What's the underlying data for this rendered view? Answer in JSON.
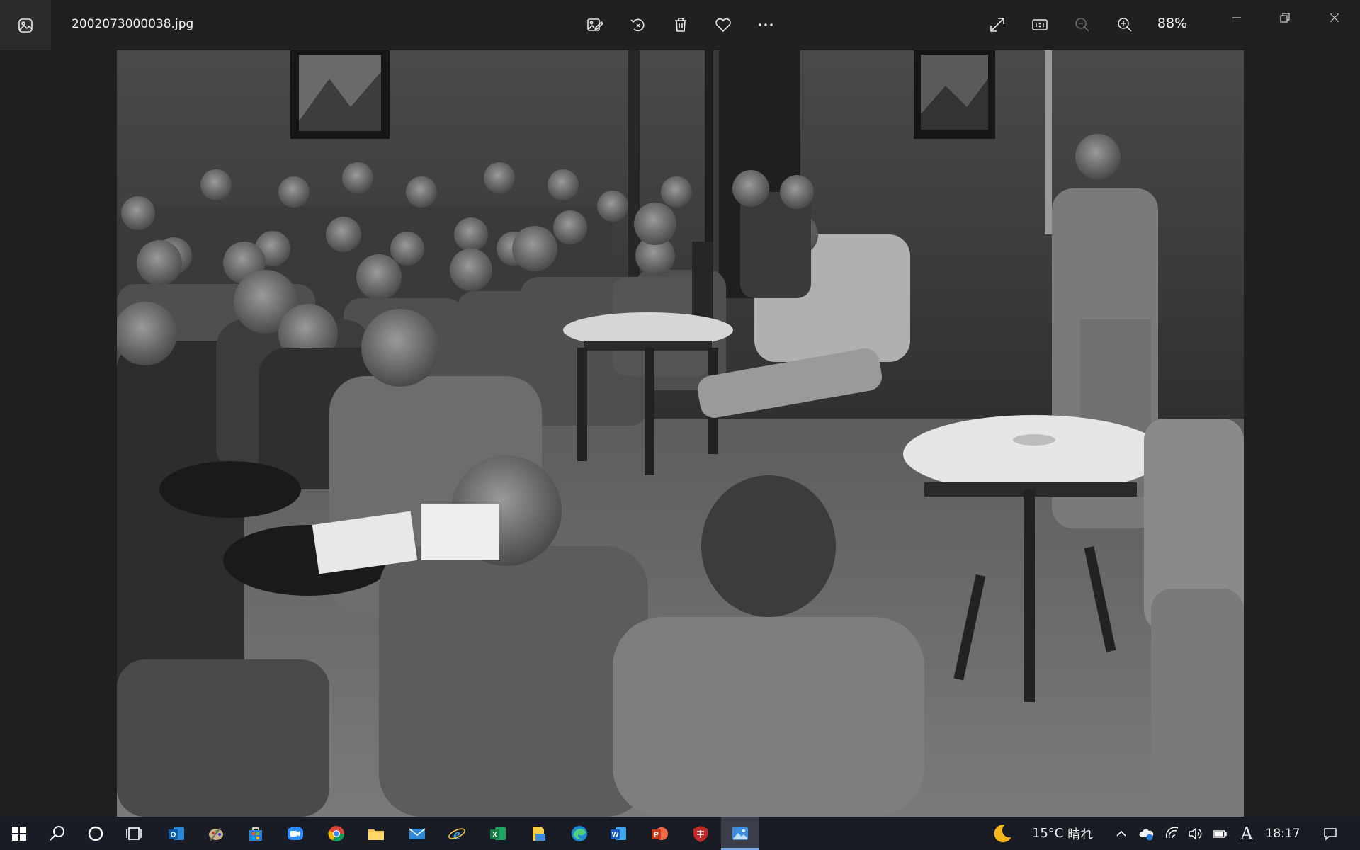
{
  "window": {
    "file_name": "2002073000038.jpg",
    "zoom_level": "88%"
  },
  "toolbar": {
    "app_icon": "photos-app-icon",
    "actions": [
      "edit-icon",
      "rotate-icon",
      "delete-icon",
      "favorite-icon",
      "more-icon"
    ],
    "view_actions": [
      "fullscreen-icon",
      "actual-size-icon",
      "zoom-out-icon",
      "zoom-in-icon"
    ]
  },
  "window_controls": [
    "minimize-icon",
    "restore-icon",
    "close-icon"
  ],
  "taskbar": {
    "apps": [
      "start-icon",
      "search-icon",
      "cortana-icon",
      "task-view-icon",
      "outlook-icon",
      "paint-icon",
      "store-icon",
      "zoom-icon",
      "chrome-icon",
      "file-explorer-icon",
      "mail-icon",
      "internet-explorer-icon",
      "excel-icon",
      "sticky-folder-icon",
      "edge-icon",
      "word-icon",
      "powerpoint-icon",
      "shield-app-icon",
      "photos-icon"
    ],
    "weather_temp": "15°C",
    "weather_text": "晴れ",
    "ime": "A",
    "clock": "18:17"
  },
  "colors": {
    "titlebar": "#202020",
    "taskbar": "#1a1c25",
    "active_task": "#3a3d4a"
  }
}
